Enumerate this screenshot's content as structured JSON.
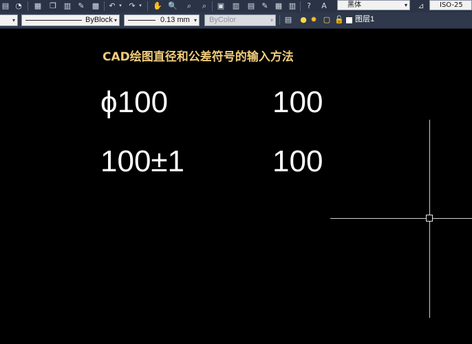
{
  "toolbar": {
    "text_style_value": "黑体",
    "dim_style_value": "ISO-25"
  },
  "properties_bar": {
    "linetype_value": "ByBlock",
    "lineweight_value": "0.13 mm",
    "plotstyle_value": "ByColor",
    "layer_value": "图层1"
  },
  "canvas": {
    "heading": "CAD绘图直径和公差符号的输入方法",
    "left_row1": "ϕ100",
    "right_row1": "100",
    "left_row2": "100±1",
    "right_row2": "100"
  },
  "colors": {
    "background": "#000000",
    "heading": "#f0cc7a",
    "text": "#ffffff",
    "toolbar": "#2f394b"
  }
}
